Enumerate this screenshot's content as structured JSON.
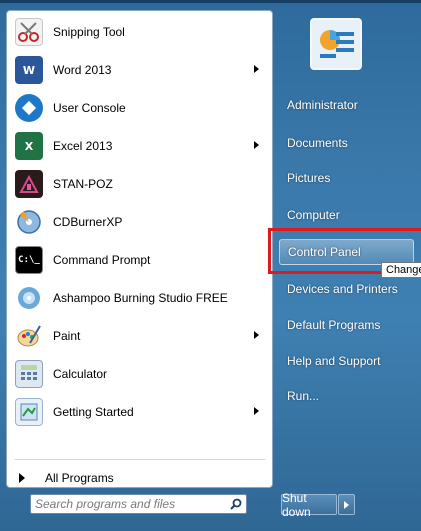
{
  "left": {
    "items": [
      {
        "label": "Snipping Tool",
        "icon": "scissors-icon",
        "submenu": false
      },
      {
        "label": "Word 2013",
        "icon": "word-icon",
        "submenu": true
      },
      {
        "label": "User Console",
        "icon": "user-console-icon",
        "submenu": false
      },
      {
        "label": "Excel 2013",
        "icon": "excel-icon",
        "submenu": true
      },
      {
        "label": "STAN-POZ",
        "icon": "stan-poz-icon",
        "submenu": false
      },
      {
        "label": "CDBurnerXP",
        "icon": "cd-burner-icon",
        "submenu": false
      },
      {
        "label": "Command Prompt",
        "icon": "command-prompt-icon",
        "submenu": false
      },
      {
        "label": "Ashampoo Burning Studio FREE",
        "icon": "ashampoo-icon",
        "submenu": false
      },
      {
        "label": "Paint",
        "icon": "paint-icon",
        "submenu": true
      },
      {
        "label": "Calculator",
        "icon": "calculator-icon",
        "submenu": false
      },
      {
        "label": "Getting Started",
        "icon": "getting-started-icon",
        "submenu": true
      }
    ],
    "all_programs": "All Programs",
    "search_placeholder": "Search programs and files"
  },
  "right": {
    "items": [
      {
        "label": "Administrator"
      },
      {
        "label": "Documents"
      },
      {
        "label": "Pictures"
      },
      {
        "label": "Computer"
      },
      {
        "label": "Control Panel",
        "highlighted": true
      },
      {
        "label": "Devices and Printers"
      },
      {
        "label": "Default Programs"
      },
      {
        "label": "Help and Support"
      },
      {
        "label": "Run..."
      }
    ],
    "tooltip": "Change",
    "shutdown": "Shut down"
  },
  "colors": {
    "accent_red": "#e01a1a",
    "menu_blue": "#3a78aa"
  }
}
